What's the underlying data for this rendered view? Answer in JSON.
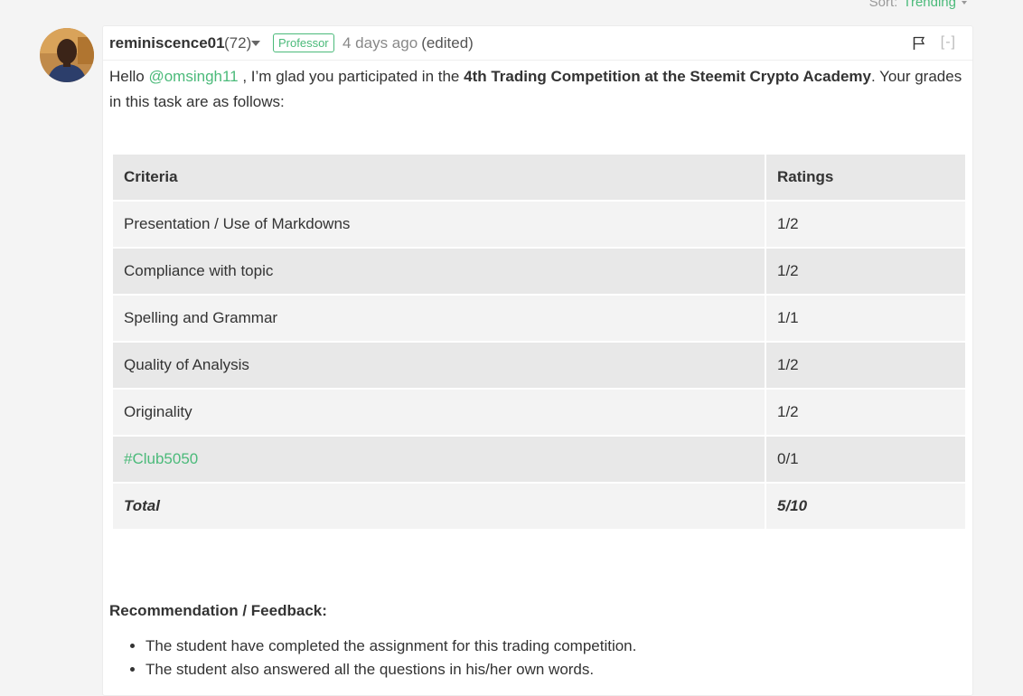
{
  "sort": {
    "label": "Sort:",
    "value": "Trending"
  },
  "comment": {
    "author": "reminiscence01",
    "reputation": "(72)",
    "badge": "Professor",
    "time": "4 days ago",
    "edited": "(edited)",
    "collapse": "[-]",
    "intro": {
      "greeting": "Hello ",
      "mention": "@omsingh11",
      "mid": " , I’m glad you participated in the ",
      "bold": "4th Trading Competition at the Steemit Crypto Academy",
      "end": ". Your grades in this task are as follows:"
    },
    "table": {
      "headers": [
        "Criteria",
        "Ratings"
      ],
      "rows": [
        {
          "criteria": "Presentation / Use of Markdowns",
          "rating": "1/2"
        },
        {
          "criteria": "Compliance with topic",
          "rating": "1/2"
        },
        {
          "criteria": "Spelling and Grammar",
          "rating": "1/1"
        },
        {
          "criteria": "Quality of Analysis",
          "rating": "1/2"
        },
        {
          "criteria": "Originality",
          "rating": "1/2"
        },
        {
          "criteria": "#Club5050",
          "rating": "0/1"
        }
      ],
      "total": {
        "label": "Total",
        "value": "5/10"
      }
    },
    "feedback": {
      "heading": "Recommendation / Feedback:",
      "items": [
        "The student have completed the assignment for this trading competition.",
        "The student also answered all the questions in his/her own words."
      ]
    }
  },
  "colors": {
    "accent": "#4bba7a",
    "background": "#f4f4f4",
    "card": "#ffffff"
  }
}
